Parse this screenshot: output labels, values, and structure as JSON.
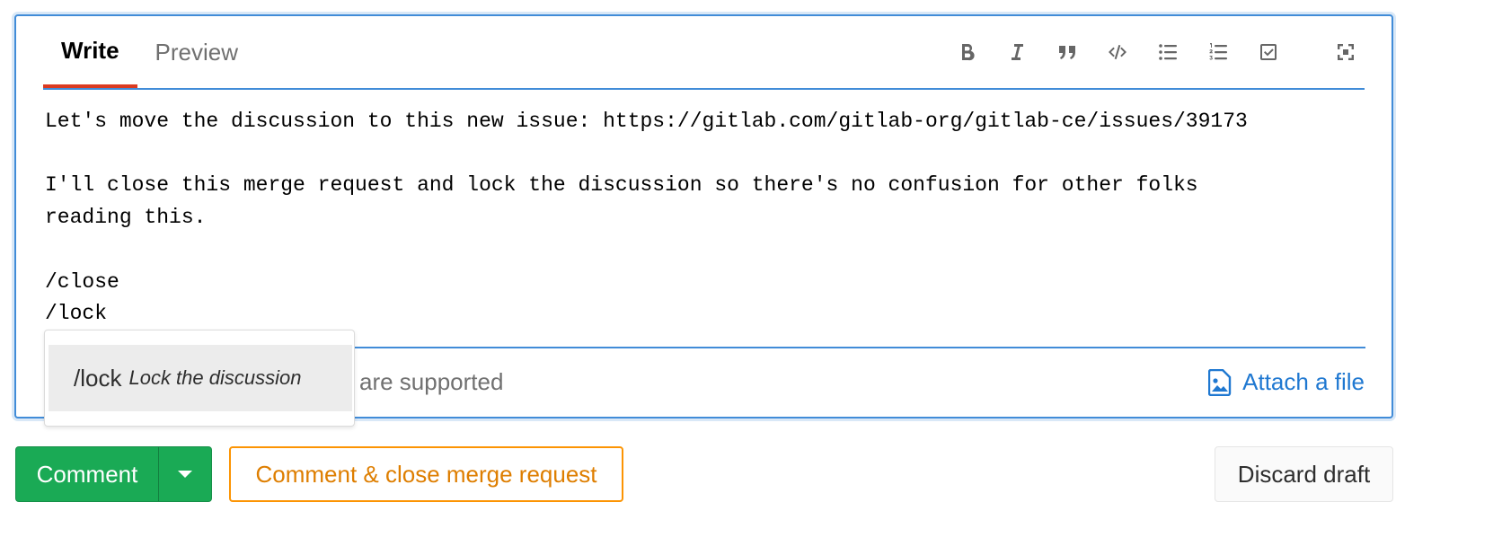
{
  "tabs": [
    {
      "label": "Write",
      "active": true
    },
    {
      "label": "Preview",
      "active": false
    }
  ],
  "toolbar": {
    "icons": [
      "bold-icon",
      "italic-icon",
      "quote-icon",
      "code-icon",
      "bulleted-list-icon",
      "numbered-list-icon",
      "task-list-icon",
      "fullscreen-icon"
    ]
  },
  "editor": {
    "text": "Let's move the discussion to this new issue: https://gitlab.com/gitlab-org/gitlab-ce/issues/39173\n\nI'll close this merge request and lock the discussion so there's no confusion for other folks\nreading this.\n\n/close\n/lock"
  },
  "footer": {
    "markdown_hint": "are supported",
    "attach_label": "Attach a file"
  },
  "autocomplete": {
    "items": [
      {
        "command": "/lock",
        "description": "Lock the discussion"
      }
    ]
  },
  "buttons": {
    "comment": "Comment",
    "comment_close": "Comment & close merge request",
    "discard": "Discard draft"
  },
  "colors": {
    "focus_border": "#418cd8",
    "active_tab_underline": "#db3b21",
    "comment_green": "#1aaa55",
    "warning_orange": "#fc9403",
    "link_blue": "#1f78d1"
  }
}
